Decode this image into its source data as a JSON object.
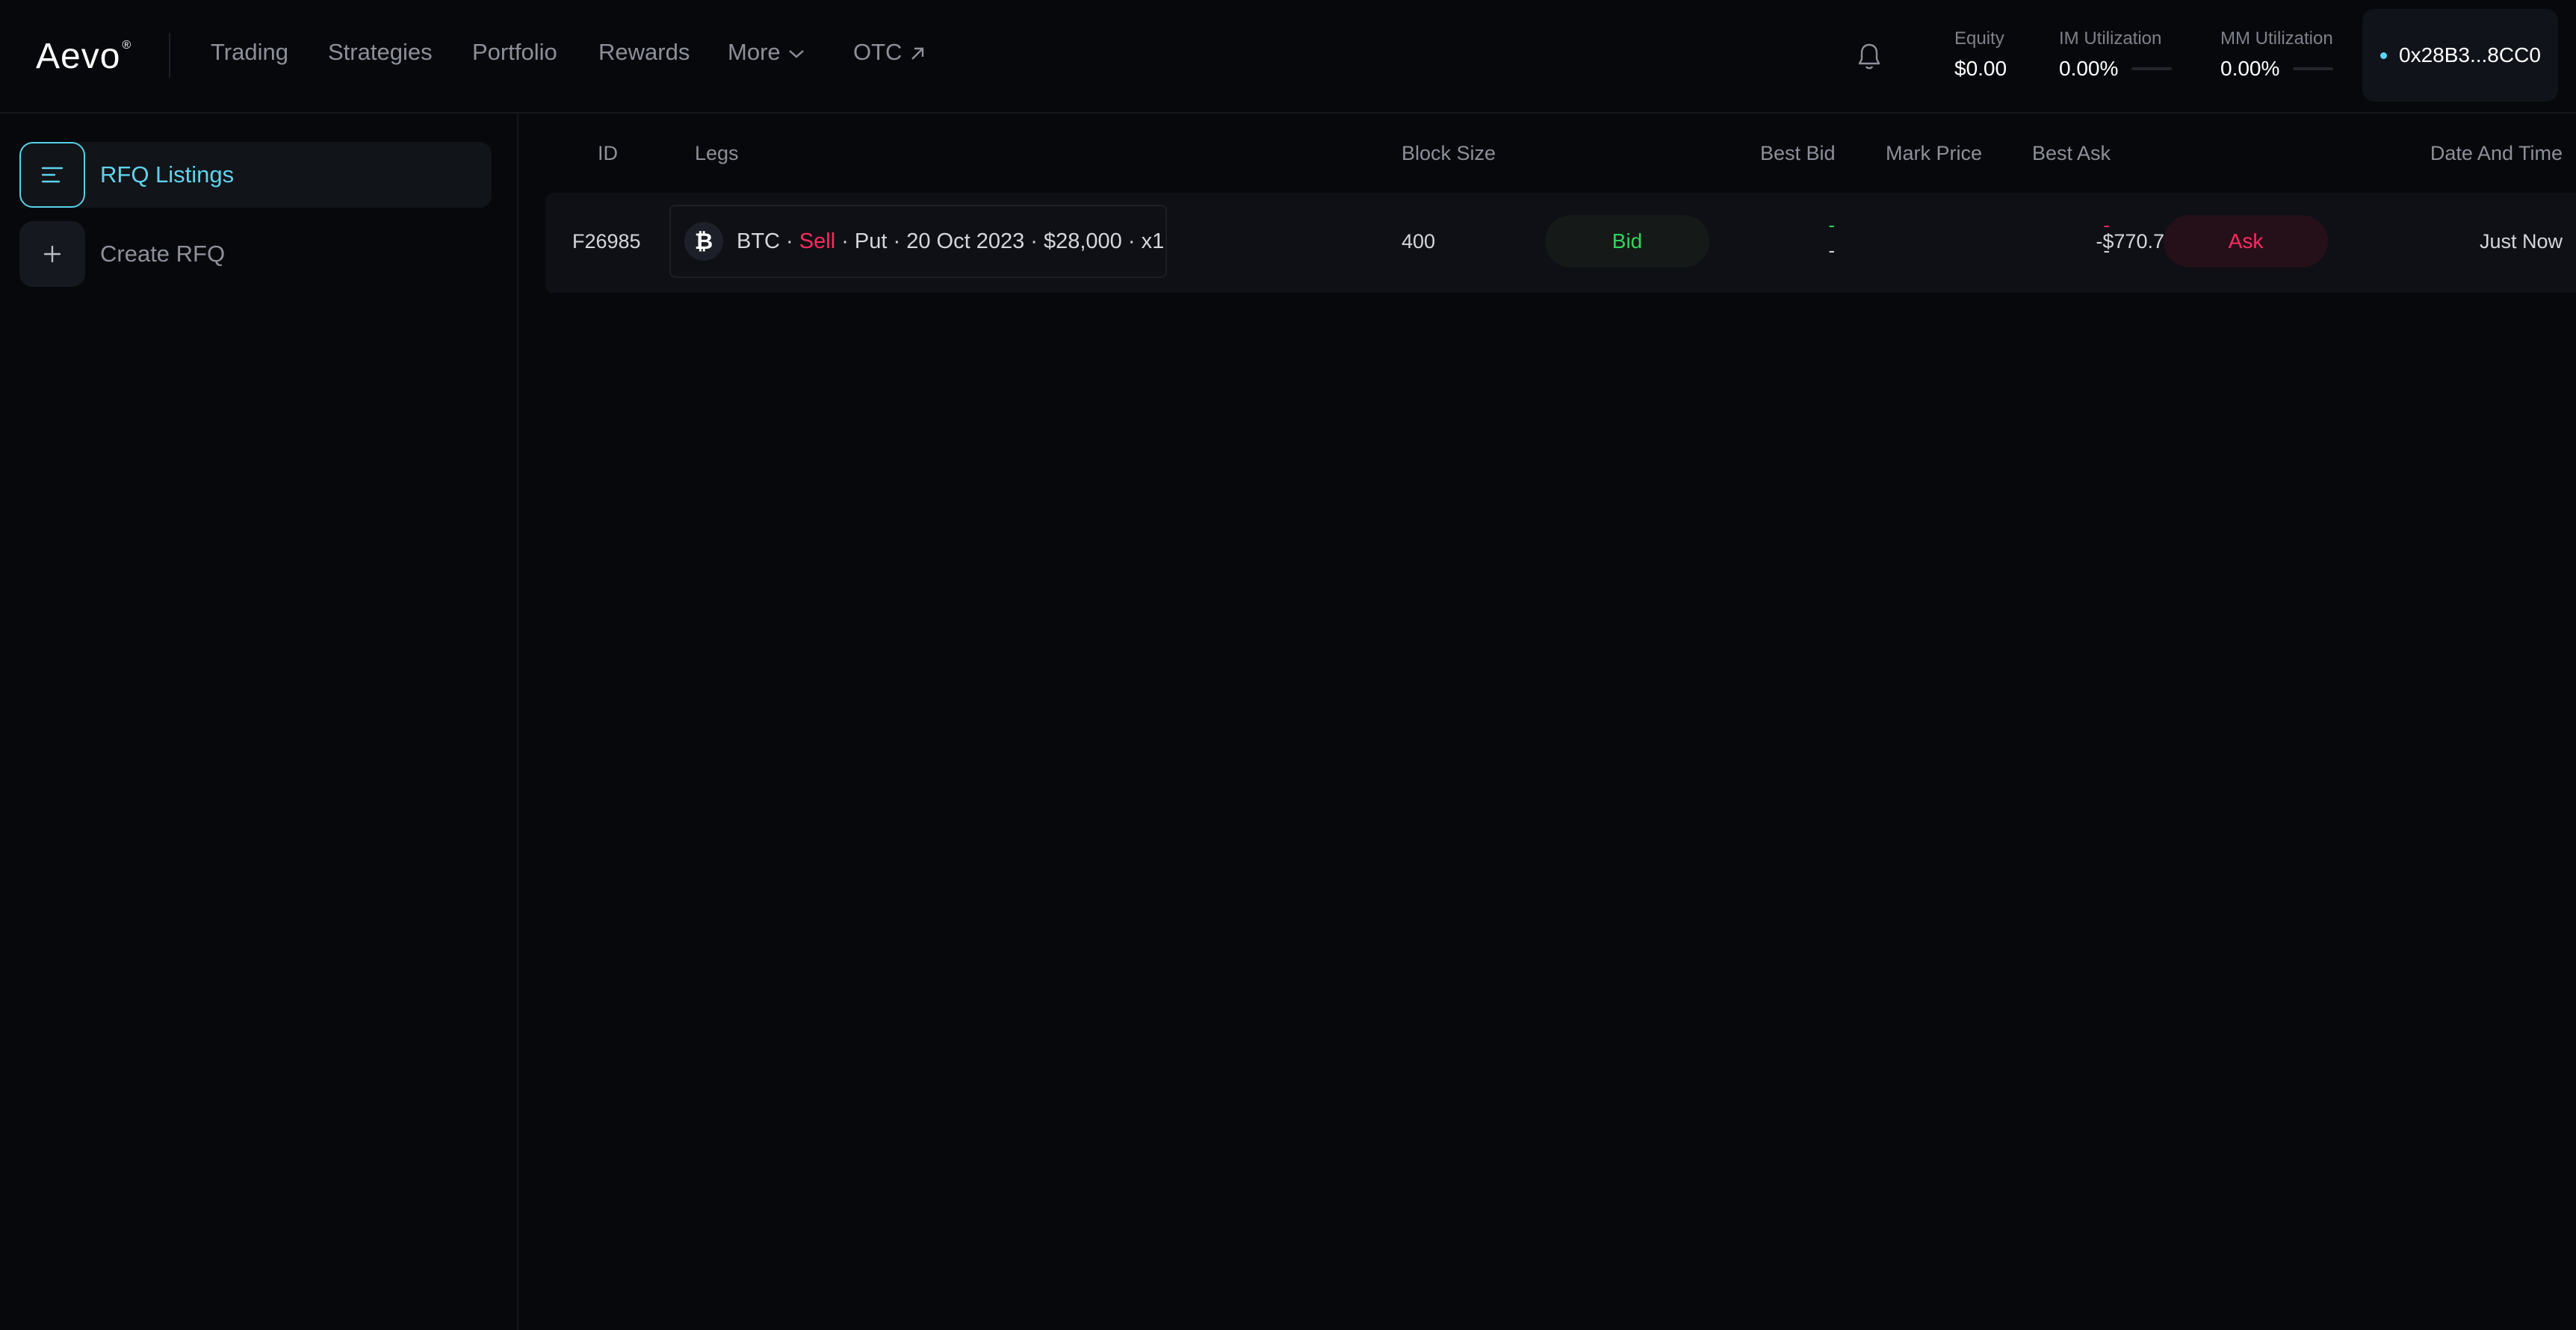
{
  "header": {
    "logo": "Aevo",
    "logo_mark": "®",
    "nav": [
      {
        "label": "Trading"
      },
      {
        "label": "Strategies"
      },
      {
        "label": "Portfolio"
      },
      {
        "label": "Rewards"
      },
      {
        "label": "More"
      },
      {
        "label": "OTC"
      }
    ],
    "stats": {
      "equity": {
        "label": "Equity",
        "value": "$0.00"
      },
      "im": {
        "label": "IM Utilization",
        "value": "0.00%"
      },
      "mm": {
        "label": "MM Utilization",
        "value": "0.00%"
      }
    },
    "wallet": {
      "address": "0x28B3...8CC0",
      "status_color": "#5ad6ff"
    }
  },
  "sidebar": {
    "items": [
      {
        "label": "RFQ Listings",
        "icon": "list-icon",
        "active": true
      },
      {
        "label": "Create RFQ",
        "icon": "plus-icon",
        "active": false
      }
    ]
  },
  "table": {
    "columns": [
      "ID",
      "Legs",
      "Block Size",
      "Best Bid",
      "Mark Price",
      "Best Ask",
      "Date And Time"
    ],
    "rows": [
      {
        "id": "F26985",
        "leg": {
          "asset": "BTC",
          "sep1": " · ",
          "side": "Sell",
          "rest": " · Put · 20 Oct 2023 · $28,000 · x1"
        },
        "block_size": "400",
        "bid_button": "Bid",
        "best_bid": [
          "-",
          "-"
        ],
        "mark_price": "-$770.72",
        "best_ask": [
          "-",
          "-"
        ],
        "ask_button": "Ask",
        "date_time": "Just Now"
      }
    ]
  },
  "colors": {
    "background": "#07080c",
    "accent": "#5fd3ee",
    "bid_green": "#31d35a",
    "ask_red": "#ff2a5f"
  }
}
